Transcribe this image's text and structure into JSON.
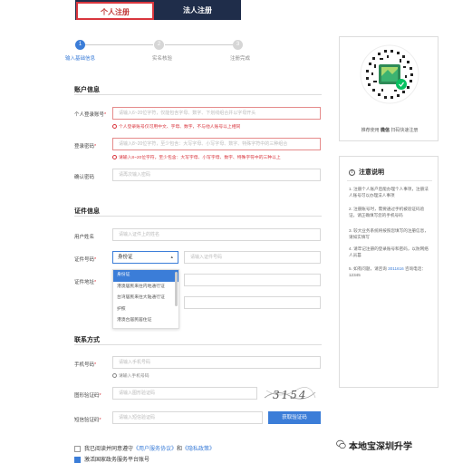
{
  "tabs": [
    {
      "label": "个人注册",
      "active": true
    },
    {
      "label": "法人注册",
      "active": false
    }
  ],
  "steps": [
    {
      "num": "1",
      "label": "输入基础信息"
    },
    {
      "num": "2",
      "label": "实名核验"
    },
    {
      "num": "3",
      "label": "注册完成"
    }
  ],
  "account": {
    "title": "账户信息",
    "login_label": "个人登录账号",
    "login_placeholder": "请输入6~20位字符，仅能包含字母、数字、下划线组合并以字母开头",
    "login_hint": "个人登录账号仅可用中文、字母、数字，不与他人账号以上相同",
    "password_label": "登录密码",
    "password_placeholder": "请输入8~20位字符，至少包含：大写字母、小写字母、数字、特殊字符中的三种组合",
    "password_hint": "请输入8~20位字符，至少包含：大写字母、小写字母、数字、特殊字符中的三种以上",
    "confirm_label": "确认密码",
    "confirm_placeholder": "请再次输入密码"
  },
  "certificate": {
    "title": "证件信息",
    "name_label": "用户姓名",
    "name_placeholder": "请输入证件上的姓名",
    "id_label": "证件号码",
    "id_type_selected": "身份证",
    "id_placeholder": "请输入证件号码",
    "address_label": "证件地址",
    "dropdown_options": [
      "身份证",
      "港澳居民来往内地通行证",
      "台湾居民来往大陆通行证",
      "护照",
      "港澳台居民居住证"
    ]
  },
  "contact": {
    "title": "联系方式",
    "phone_label": "手机号码",
    "phone_placeholder": "请输入手机号码",
    "phone_hint": "请输入手机号码",
    "captcha_label": "图形验证码",
    "captcha_placeholder": "请输入图形验证码",
    "captcha_text": "3154",
    "sms_label": "短信验证码",
    "sms_placeholder": "请输入短信验证码",
    "get_code_label": "获取验证码"
  },
  "agreement": {
    "prefix": "我已阅读并同意遵守",
    "service_link": "《用户服务协议》",
    "and": "和",
    "privacy_link": "《隐私政策》",
    "activate": "激活国家政务服务平台账号"
  },
  "qr": {
    "caption_prefix": "推荐使用",
    "caption_bold": "微信",
    "caption_suffix": "扫码快速注册"
  },
  "notice": {
    "title": "注意说明",
    "items": [
      "1. 注册个人账户后能办理个人事项，注册法人账号可以办理法人事项",
      "2. 注册账号时，需要通过手机被验证码验证，请正确填写您的手机号码",
      "3. 较大业务系统将按照您填写的注册信息，请如实填写",
      "4. 请牢记注册的登录账号和密码，以防网络人员篡",
      "5. 如有问题，请咨询"
    ],
    "hotline_link": "3011616",
    "hotline_suffix": "咨询电话：12345"
  },
  "watermark": "本地宝深圳升学",
  "colors": {
    "accent": "#3b7dd8",
    "error": "#d9363e",
    "nav": "#1f2d4a"
  }
}
